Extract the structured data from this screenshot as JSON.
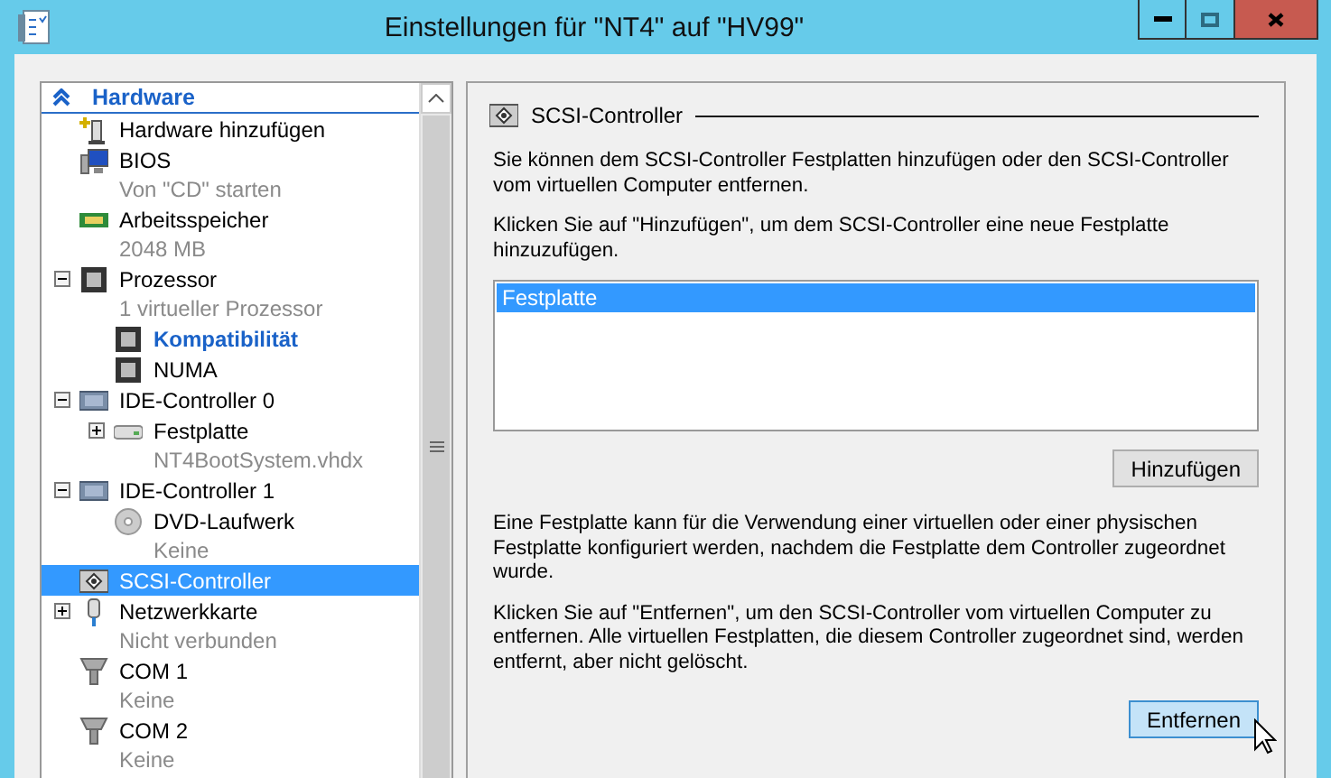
{
  "window": {
    "title": "Einstellungen für \"NT4\" auf \"HV99\""
  },
  "tree": {
    "header": "Hardware",
    "items": [
      {
        "kind": "add",
        "label": "Hardware hinzufügen",
        "selected": false
      },
      {
        "kind": "bios",
        "label": "BIOS",
        "detail": "Von \"CD\" starten",
        "selected": false
      },
      {
        "kind": "memory",
        "label": "Arbeitsspeicher",
        "detail": "2048 MB",
        "selected": false
      },
      {
        "kind": "cpu",
        "label": "Prozessor",
        "detail": "1 virtueller Prozessor",
        "selected": false,
        "expanded": true,
        "children": [
          {
            "kind": "cpu",
            "label": "Kompatibilität",
            "selected": false,
            "emphasized": true
          },
          {
            "kind": "cpu",
            "label": "NUMA",
            "selected": false,
            "emphasized": false
          }
        ]
      },
      {
        "kind": "controller",
        "label": "IDE-Controller 0",
        "selected": false,
        "expanded": true,
        "children": [
          {
            "kind": "disk",
            "label": "Festplatte",
            "detail": "NT4BootSystem.vhdx",
            "selected": false,
            "expanded": false
          }
        ]
      },
      {
        "kind": "controller",
        "label": "IDE-Controller 1",
        "selected": false,
        "expanded": true,
        "children": [
          {
            "kind": "dvd",
            "label": "DVD-Laufwerk",
            "detail": "Keine",
            "selected": false
          }
        ]
      },
      {
        "kind": "scsi",
        "label": "SCSI-Controller",
        "selected": true
      },
      {
        "kind": "network",
        "label": "Netzwerkkarte",
        "detail": "Nicht verbunden",
        "selected": false,
        "expanded": false
      },
      {
        "kind": "com",
        "label": "COM 1",
        "detail": "Keine",
        "selected": false
      },
      {
        "kind": "com",
        "label": "COM 2",
        "detail": "Keine",
        "selected": false
      }
    ]
  },
  "panel": {
    "title": "SCSI-Controller",
    "intro": "Sie können dem SCSI-Controller Festplatten hinzufügen oder den SCSI-Controller vom virtuellen Computer entfernen.",
    "add_hint": "Klicken Sie auf \"Hinzufügen\", um dem SCSI-Controller eine neue Festplatte hinzuzufügen.",
    "list": [
      {
        "label": "Festplatte",
        "selected": true
      }
    ],
    "add_button": {
      "label": "Hinzufügen",
      "hovered": false
    },
    "disk_note": "Eine Festplatte kann für die Verwendung einer virtuellen oder einer physischen Festplatte konfiguriert werden, nachdem die Festplatte dem Controller zugeordnet wurde.",
    "remove_hint": "Klicken Sie auf \"Entfernen\", um den SCSI-Controller vom virtuellen Computer zu entfernen. Alle virtuellen Festplatten, die diesem Controller zugeordnet sind, werden entfernt, aber nicht gelöscht.",
    "remove_button": {
      "label": "Entfernen",
      "hovered": true
    }
  }
}
